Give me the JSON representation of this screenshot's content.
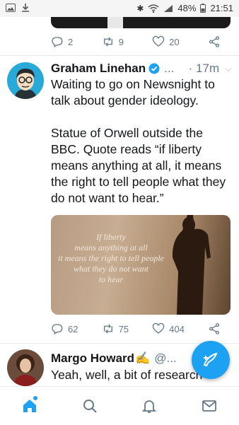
{
  "statusbar": {
    "battery": "48%",
    "time": "21:51"
  },
  "prev_tweet": {
    "replies": "2",
    "retweets": "9",
    "likes": "20"
  },
  "tweet": {
    "name": "Graham Linehan",
    "handle": "...",
    "time": "· 17m",
    "text": "Waiting to go on Newsnight to talk about gender ideology.\n\nStatue of Orwell outside the BBC. Quote reads “if liberty means anything at all, it means the right to tell people what they do not want to hear.”",
    "image_quote": [
      "If liberty",
      "means anything at all",
      "it means the right to tell people",
      "what they do not want",
      "to hear"
    ],
    "replies": "62",
    "retweets": "75",
    "likes": "404"
  },
  "tweet2": {
    "name": "Margo Howard",
    "name_emoji": "✍",
    "handle": "@...",
    "text": "Yeah, well, a bit of research"
  },
  "colors": {
    "accent": "#1da1f2",
    "muted": "#657786"
  },
  "icons": [
    "reply-icon",
    "retweet-icon",
    "like-icon",
    "share-icon",
    "home-icon",
    "search-icon",
    "notifications-icon",
    "messages-icon",
    "compose-icon"
  ]
}
